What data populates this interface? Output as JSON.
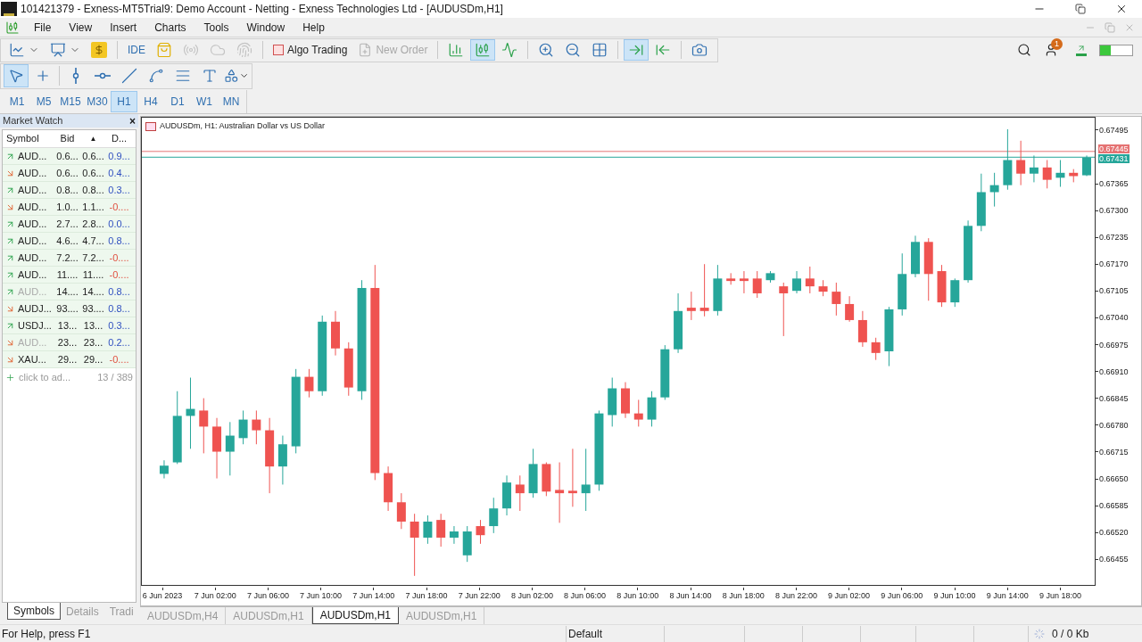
{
  "window": {
    "title": "101421379 - Exness-MT5Trial9: Demo Account - Netting - Exness Technologies Ltd - [AUDUSDm,H1]"
  },
  "menu": [
    "File",
    "View",
    "Insert",
    "Charts",
    "Tools",
    "Window",
    "Help"
  ],
  "toolbar": [
    {
      "kind": "icon",
      "disabled": false,
      "selected": false
    },
    {
      "kind": "icon",
      "disabled": false,
      "selected": false
    },
    {
      "kind": "icon",
      "disabled": false,
      "selected": false
    },
    {
      "kind": "text",
      "label": "IDE",
      "disabled": false,
      "selected": false
    },
    {
      "kind": "icon",
      "disabled": false,
      "selected": false
    },
    {
      "kind": "icon",
      "disabled": true,
      "selected": false
    },
    {
      "kind": "icon",
      "disabled": true,
      "selected": false
    },
    {
      "kind": "icon",
      "disabled": true,
      "selected": false
    },
    {
      "kind": "text",
      "label": "Algo Trading",
      "disabled": false,
      "selected": false
    },
    {
      "kind": "text",
      "label": "New Order",
      "disabled": true,
      "selected": false
    },
    {
      "kind": "icon",
      "disabled": false,
      "selected": false
    },
    {
      "kind": "icon",
      "disabled": false,
      "selected": true
    },
    {
      "kind": "icon",
      "disabled": false,
      "selected": false
    },
    {
      "kind": "icon",
      "disabled": false,
      "selected": false
    },
    {
      "kind": "icon",
      "disabled": false,
      "selected": false
    },
    {
      "kind": "icon",
      "disabled": false,
      "selected": false
    },
    {
      "kind": "icon",
      "disabled": false,
      "selected": true
    },
    {
      "kind": "icon",
      "disabled": false,
      "selected": false
    },
    {
      "kind": "icon",
      "disabled": false,
      "selected": false
    }
  ],
  "notifications": {
    "count": "1"
  },
  "drawing_tools": [
    {
      "selected": true
    },
    {
      "selected": false
    },
    {
      "selected": false
    },
    {
      "selected": false
    },
    {
      "selected": false
    },
    {
      "selected": false
    },
    {
      "selected": false
    },
    {
      "selected": false
    },
    {
      "selected": false
    }
  ],
  "timeframes": [
    {
      "label": "M1",
      "selected": false
    },
    {
      "label": "M5",
      "selected": false
    },
    {
      "label": "M15",
      "selected": false
    },
    {
      "label": "M30",
      "selected": false
    },
    {
      "label": "H1",
      "selected": true
    },
    {
      "label": "H4",
      "selected": false
    },
    {
      "label": "D1",
      "selected": false
    },
    {
      "label": "W1",
      "selected": false
    },
    {
      "label": "MN",
      "selected": false
    }
  ],
  "market_watch": {
    "title": "Market Watch",
    "close": "×",
    "columns": [
      "Symbol",
      "Bid",
      "▲",
      "D..."
    ],
    "rows": [
      {
        "symbol": "AUD...",
        "bid": "0.6...",
        "ask": "0.6...",
        "daily": "0.9...",
        "rising": true,
        "dimmed": false,
        "falling": false
      },
      {
        "symbol": "AUD...",
        "bid": "0.6...",
        "ask": "0.6...",
        "daily": "0.4...",
        "rising": false,
        "dimmed": false,
        "falling": false
      },
      {
        "symbol": "AUD...",
        "bid": "0.8...",
        "ask": "0.8...",
        "daily": "0.3...",
        "rising": true,
        "dimmed": false,
        "falling": false
      },
      {
        "symbol": "AUD...",
        "bid": "1.0...",
        "ask": "1.1...",
        "daily": "-0....",
        "rising": false,
        "dimmed": false,
        "falling": true
      },
      {
        "symbol": "AUD...",
        "bid": "2.7...",
        "ask": "2.8...",
        "daily": "0.0...",
        "rising": true,
        "dimmed": false,
        "falling": false
      },
      {
        "symbol": "AUD...",
        "bid": "4.6...",
        "ask": "4.7...",
        "daily": "0.8...",
        "rising": true,
        "dimmed": false,
        "falling": false
      },
      {
        "symbol": "AUD...",
        "bid": "7.2...",
        "ask": "7.2...",
        "daily": "-0....",
        "rising": true,
        "dimmed": false,
        "falling": true
      },
      {
        "symbol": "AUD...",
        "bid": "11....",
        "ask": "11....",
        "daily": "-0....",
        "rising": true,
        "dimmed": false,
        "falling": true
      },
      {
        "symbol": "AUD...",
        "bid": "14....",
        "ask": "14....",
        "daily": "0.8...",
        "rising": true,
        "dimmed": true,
        "falling": false
      },
      {
        "symbol": "AUDJ...",
        "bid": "93....",
        "ask": "93....",
        "daily": "0.8...",
        "rising": false,
        "dimmed": false,
        "falling": false
      },
      {
        "symbol": "USDJ...",
        "bid": "13...",
        "ask": "13...",
        "daily": "0.3...",
        "rising": true,
        "dimmed": false,
        "falling": false
      },
      {
        "symbol": "AUD...",
        "bid": "23...",
        "ask": "23...",
        "daily": "0.2...",
        "rising": false,
        "dimmed": true,
        "falling": false
      },
      {
        "symbol": "XAU...",
        "bid": "29...",
        "ask": "29...",
        "daily": "-0....",
        "rising": false,
        "dimmed": false,
        "falling": true
      }
    ],
    "add_row": {
      "text": "click to ad...",
      "count": "13 / 389"
    },
    "tabs": [
      {
        "label": "Symbols",
        "selected": true
      },
      {
        "label": "Details",
        "selected": false
      },
      {
        "label": "Tradi",
        "selected": false
      }
    ]
  },
  "chart": {
    "title": "AUDUSDm, H1:  Australian Dollar vs US Dollar",
    "ask_tag": "0.67445",
    "bid_tag": "0.67431",
    "chart_data": {
      "type": "candlestick",
      "ylim": [
        0.66391,
        0.67527
      ],
      "ref_lines": [
        {
          "axis": "y",
          "value": 0.67445,
          "color": "#e57373"
        },
        {
          "axis": "y",
          "value": 0.67431,
          "color": "#26a69a"
        }
      ],
      "categories": [
        "6 Jun 2023",
        null,
        null,
        null,
        "7 Jun 02:00",
        null,
        null,
        null,
        "7 Jun 06:00",
        null,
        null,
        null,
        "7 Jun 10:00",
        null,
        null,
        null,
        "7 Jun 14:00",
        null,
        null,
        null,
        "7 Jun 18:00",
        null,
        null,
        null,
        "7 Jun 22:00",
        null,
        null,
        null,
        "8 Jun 02:00",
        null,
        null,
        null,
        "8 Jun 06:00",
        null,
        null,
        null,
        "8 Jun 10:00",
        null,
        null,
        null,
        "8 Jun 14:00",
        null,
        null,
        null,
        "8 Jun 18:00",
        null,
        null,
        null,
        "8 Jun 22:00",
        null,
        null,
        null,
        "9 Jun 02:00",
        null,
        null,
        null,
        "9 Jun 06:00",
        null,
        null,
        null,
        "9 Jun 10:00",
        null,
        null,
        null,
        "9 Jun 14:00",
        null,
        null,
        null,
        "9 Jun 18:00",
        null,
        null
      ],
      "ohlc": [
        [
          0.66661,
          0.66694,
          0.6665,
          0.66681
        ],
        [
          0.66689,
          0.66862,
          0.66685,
          0.66802
        ],
        [
          0.66802,
          0.66895,
          0.66722,
          0.66819
        ],
        [
          0.66815,
          0.66845,
          0.66711,
          0.66776
        ],
        [
          0.66776,
          0.66797,
          0.6665,
          0.66715
        ],
        [
          0.66715,
          0.66787,
          0.66657,
          0.66754
        ],
        [
          0.66748,
          0.66815,
          0.66733,
          0.66793
        ],
        [
          0.66793,
          0.66815,
          0.66733,
          0.66767
        ],
        [
          0.66767,
          0.66797,
          0.66614,
          0.66679
        ],
        [
          0.66679,
          0.66754,
          0.66635,
          0.66733
        ],
        [
          0.66728,
          0.66916,
          0.66711,
          0.66897
        ],
        [
          0.66897,
          0.66916,
          0.66847,
          0.66862
        ],
        [
          0.66862,
          0.67046,
          0.66851,
          0.67031
        ],
        [
          0.67031,
          0.67057,
          0.66949,
          0.66966
        ],
        [
          0.66966,
          0.66981,
          0.66851,
          0.66871
        ],
        [
          0.66862,
          0.67132,
          0.66841,
          0.67113
        ],
        [
          0.67113,
          0.67169,
          0.66646,
          0.66663
        ],
        [
          0.66663,
          0.66679,
          0.66571,
          0.66592
        ],
        [
          0.66592,
          0.66614,
          0.66527,
          0.66545
        ],
        [
          0.66545,
          0.66564,
          0.66413,
          0.66506
        ],
        [
          0.66506,
          0.6656,
          0.66491,
          0.66545
        ],
        [
          0.66549,
          0.66564,
          0.66484,
          0.66506
        ],
        [
          0.66506,
          0.66534,
          0.66491,
          0.66521
        ],
        [
          0.66463,
          0.66534,
          0.66447,
          0.66521
        ],
        [
          0.66534,
          0.66549,
          0.66491,
          0.66512
        ],
        [
          0.66534,
          0.66603,
          0.66517,
          0.66577
        ],
        [
          0.66577,
          0.66657,
          0.6656,
          0.6664
        ],
        [
          0.66635,
          0.66657,
          0.66571,
          0.66614
        ],
        [
          0.66614,
          0.66722,
          0.66603,
          0.66685
        ],
        [
          0.66685,
          0.66689,
          0.66607,
          0.66618
        ],
        [
          0.66622,
          0.66689,
          0.66542,
          0.66614
        ],
        [
          0.6662,
          0.66722,
          0.66581,
          0.66614
        ],
        [
          0.66614,
          0.66722,
          0.66571,
          0.66635
        ],
        [
          0.66635,
          0.66815,
          0.6662,
          0.66808
        ],
        [
          0.66804,
          0.66895,
          0.66776,
          0.66869
        ],
        [
          0.66869,
          0.66884,
          0.66797,
          0.66808
        ],
        [
          0.66808,
          0.66841,
          0.66776,
          0.66793
        ],
        [
          0.66793,
          0.66862,
          0.66776,
          0.66847
        ],
        [
          0.66847,
          0.66974,
          0.66841,
          0.66964
        ],
        [
          0.66964,
          0.671,
          0.66955,
          0.67057
        ],
        [
          0.67065,
          0.67104,
          0.67035,
          0.67057
        ],
        [
          0.67065,
          0.67171,
          0.67044,
          0.67057
        ],
        [
          0.67057,
          0.67169,
          0.67046,
          0.67136
        ],
        [
          0.67136,
          0.67149,
          0.67121,
          0.6713
        ],
        [
          0.67136,
          0.67154,
          0.671,
          0.6713
        ],
        [
          0.67136,
          0.67154,
          0.67089,
          0.671
        ],
        [
          0.67132,
          0.67154,
          0.67126,
          0.67149
        ],
        [
          0.67117,
          0.67126,
          0.66996,
          0.671
        ],
        [
          0.67106,
          0.67154,
          0.671,
          0.67136
        ],
        [
          0.67136,
          0.67165,
          0.671,
          0.67117
        ],
        [
          0.67117,
          0.67132,
          0.67093,
          0.67104
        ],
        [
          0.67104,
          0.67126,
          0.67046,
          0.67074
        ],
        [
          0.67074,
          0.67093,
          0.67031,
          0.67035
        ],
        [
          0.67035,
          0.67057,
          0.6697,
          0.66981
        ],
        [
          0.66981,
          0.66992,
          0.66938,
          0.66955
        ],
        [
          0.66959,
          0.67067,
          0.66923,
          0.67061
        ],
        [
          0.67061,
          0.67197,
          0.67046,
          0.67147
        ],
        [
          0.67147,
          0.6724,
          0.67139,
          0.67225
        ],
        [
          0.67225,
          0.67234,
          0.67082,
          0.67147
        ],
        [
          0.67154,
          0.67169,
          0.67067,
          0.67078
        ],
        [
          0.67078,
          0.67136,
          0.67067,
          0.67132
        ],
        [
          0.67132,
          0.67277,
          0.67126,
          0.67264
        ],
        [
          0.67264,
          0.67391,
          0.67251,
          0.67346
        ],
        [
          0.67346,
          0.67393,
          0.67311,
          0.67363
        ],
        [
          0.67363,
          0.67499,
          0.67352,
          0.67424
        ],
        [
          0.67424,
          0.67471,
          0.67363,
          0.67391
        ],
        [
          0.67391,
          0.67435,
          0.6737,
          0.67406
        ],
        [
          0.67406,
          0.67424,
          0.67355,
          0.67376
        ],
        [
          0.67381,
          0.67424,
          0.67359,
          0.67393
        ],
        [
          0.67393,
          0.67402,
          0.6737,
          0.67385
        ],
        [
          0.67387,
          0.67435,
          0.67385,
          0.6743
        ]
      ],
      "yticks": [
        {
          "value": 0.67495,
          "label": "0.67495"
        },
        {
          "value": 0.67365,
          "label": "0.67365"
        },
        {
          "value": 0.673,
          "label": "0.67300"
        },
        {
          "value": 0.67235,
          "label": "0.67235"
        },
        {
          "value": 0.6717,
          "label": "0.67170"
        },
        {
          "value": 0.67105,
          "label": "0.67105"
        },
        {
          "value": 0.6704,
          "label": "0.67040"
        },
        {
          "value": 0.66975,
          "label": "0.66975"
        },
        {
          "value": 0.6691,
          "label": "0.66910"
        },
        {
          "value": 0.66845,
          "label": "0.66845"
        },
        {
          "value": 0.6678,
          "label": "0.66780"
        },
        {
          "value": 0.66715,
          "label": "0.66715"
        },
        {
          "value": 0.6665,
          "label": "0.66650"
        },
        {
          "value": 0.66585,
          "label": "0.66585"
        },
        {
          "value": 0.6652,
          "label": "0.66520"
        },
        {
          "value": 0.66455,
          "label": "0.66455"
        }
      ]
    }
  },
  "chart_tabs": [
    {
      "label": "AUDUSDm,H4",
      "selected": false
    },
    {
      "label": "AUDUSDm,H1",
      "selected": false
    },
    {
      "label": "AUDUSDm,H1",
      "selected": true
    },
    {
      "label": "AUDUSDm,H1",
      "selected": false
    }
  ],
  "status_bar": {
    "help": "For Help, press F1",
    "profile": "Default",
    "traffic": "0 / 0 Kb"
  }
}
